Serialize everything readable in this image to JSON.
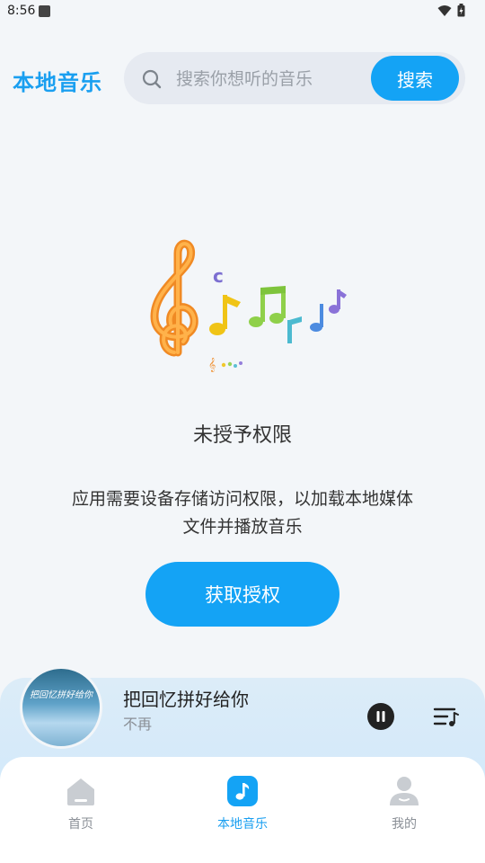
{
  "status_bar": {
    "time": "8:56"
  },
  "header": {
    "title": "本地音乐",
    "search": {
      "placeholder": "搜索你想听的音乐",
      "value": "",
      "button_label": "搜索"
    }
  },
  "empty_state": {
    "title": "未授予权限",
    "description": "应用需要设备存储访问权限，以加载本地媒体文件并播放音乐",
    "button_label": "获取授权"
  },
  "player": {
    "song_title": "把回忆拼好给你",
    "artist": "不再",
    "album_art_text": "把回忆拼好给你",
    "is_playing": true
  },
  "tabs": [
    {
      "label": "首页",
      "icon": "home-icon",
      "active": false
    },
    {
      "label": "本地音乐",
      "icon": "music-note-icon",
      "active": true
    },
    {
      "label": "我的",
      "icon": "profile-icon",
      "active": false
    }
  ],
  "colors": {
    "accent": "#14a3f5",
    "background": "#f3f6f9",
    "tab_inactive": "#c9cdd2"
  }
}
